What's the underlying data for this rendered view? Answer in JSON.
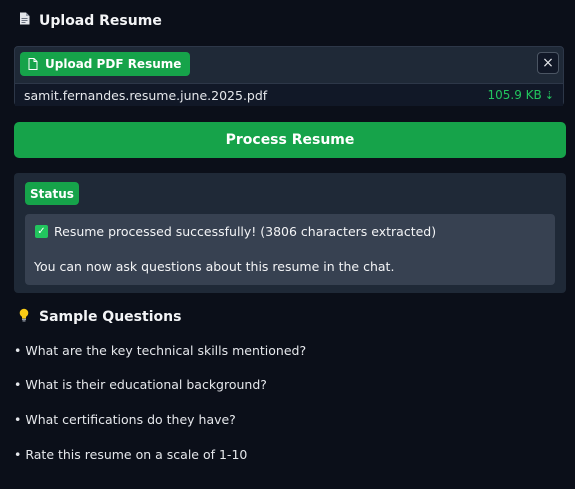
{
  "upload_section": {
    "icon": "document-icon",
    "title": "Upload Resume"
  },
  "upload": {
    "button_label": "Upload PDF Resume",
    "close_symbol": "×",
    "file_name": "samit.fernandes.resume.june.2025.pdf",
    "file_size": "105.9 KB",
    "download_symbol": "⇣"
  },
  "process_button_label": "Process Resume",
  "status": {
    "badge": "Status",
    "message": "Resume processed successfully! (3806 characters extracted)",
    "followup": "You can now ask questions about this resume in the chat."
  },
  "samples": {
    "icon": "lightbulb-icon",
    "title": "Sample Questions",
    "questions": [
      "• What are the key technical skills mentioned?",
      "• What is their educational background?",
      "• What certifications do they have?",
      "• Rate this resume on a scale of 1-10"
    ]
  },
  "colors": {
    "background": "#0b0f19",
    "accent": "#16a34a",
    "file_size": "#22c55e"
  }
}
